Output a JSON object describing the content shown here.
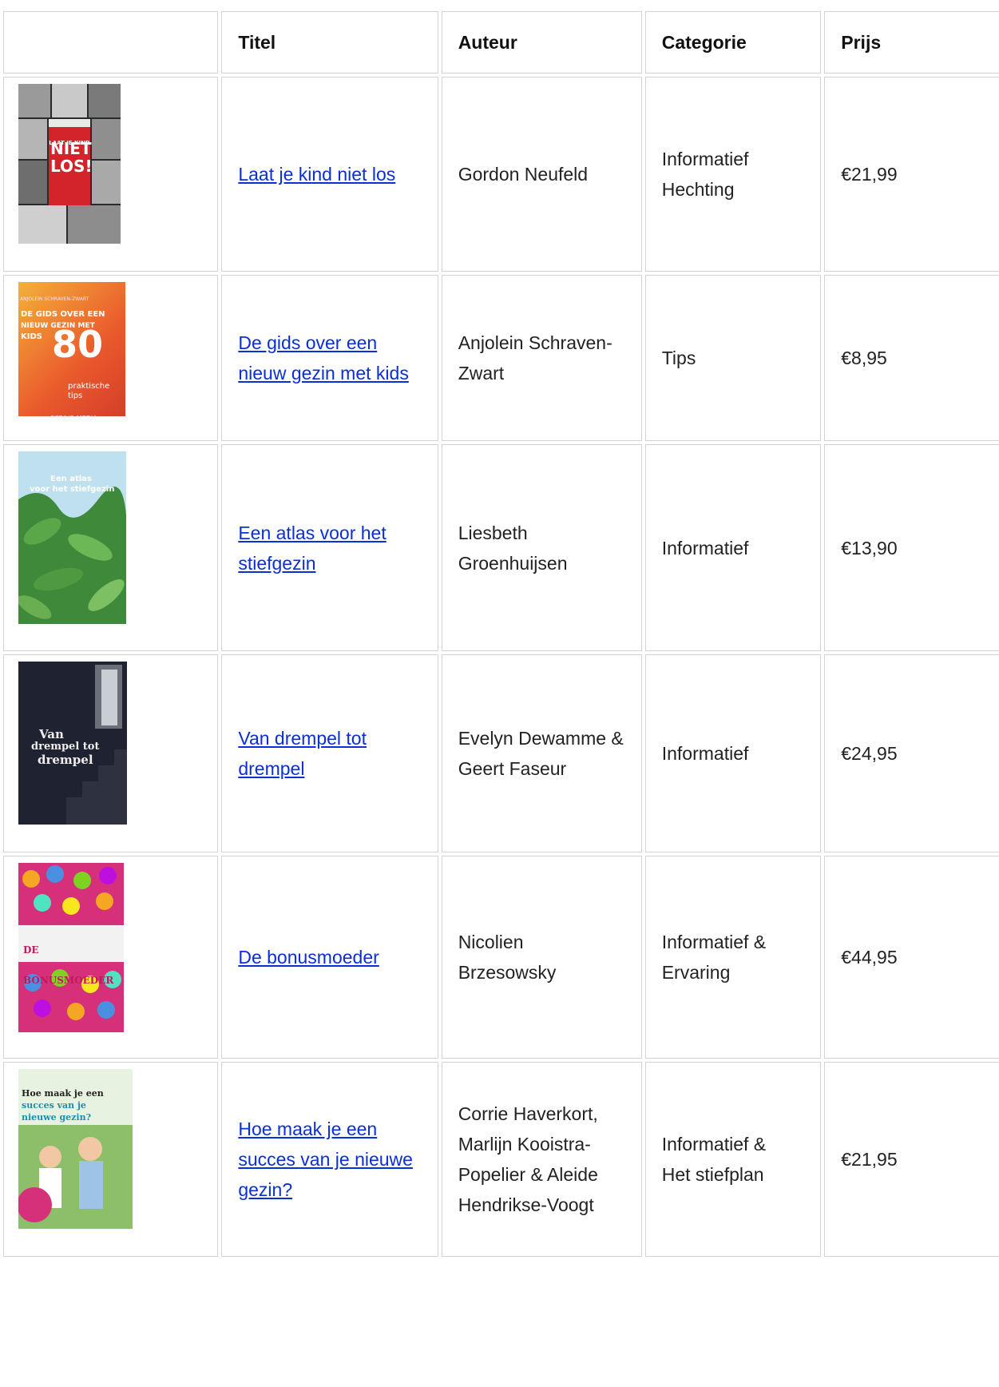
{
  "table": {
    "headers": [
      "",
      "Titel",
      "Auteur",
      "Categorie",
      "Prijs"
    ],
    "rows": [
      {
        "title": "Laat je kind niet los",
        "author": "Gordon Neufeld",
        "category_lines": [
          "Informatief",
          "Hechting"
        ],
        "price": "€21,99",
        "cover": {
          "icon": "book-cover-laat-je-kind-niet-los",
          "main": "NIET LOS!",
          "top": "LAAT JE KIND",
          "accent": "#d4242b"
        }
      },
      {
        "title": "De gids over een nieuw gezin met kids",
        "author": "Anjolein Schraven-Zwart",
        "category_lines": [
          "Tips"
        ],
        "price": "€8,95",
        "cover": {
          "icon": "book-cover-gids-nieuw-gezin",
          "top": "ANJOLEIN SCHRAVEN-ZWART",
          "l1": "DE GIDS OVER EEN",
          "l2": "NIEUW GEZIN MET",
          "l3": "KIDS",
          "big": "80",
          "sub1": "praktische",
          "sub2": "tips",
          "bottom": "SCRIVO MEDIA",
          "accent": "#f07a2a"
        }
      },
      {
        "title": "Een atlas voor het stiefgezin",
        "author": "Liesbeth Groenhuijsen",
        "category_lines": [
          "Informatief"
        ],
        "price": "€13,90",
        "cover": {
          "icon": "book-cover-atlas-stiefgezin",
          "l1": "Een atlas",
          "l2": "voor het stiefgezin",
          "accent": "#3f8a3a"
        }
      },
      {
        "title": "Van drempel tot drempel",
        "author": "Evelyn Dewamme & Geert Faseur",
        "category_lines": [
          "Informatief"
        ],
        "price": "€24,95",
        "cover": {
          "icon": "book-cover-van-drempel-tot-drempel",
          "l1": "Van",
          "l2": "drempel tot",
          "l3": "drempel",
          "accent": "#1f2230"
        }
      },
      {
        "title": "De bonusmoeder",
        "author": "Nicolien Brzesowsky",
        "category_lines": [
          "Informatief &",
          "Ervaring"
        ],
        "price": "€44,95",
        "cover": {
          "icon": "book-cover-de-bonusmoeder",
          "main": "DE BONUSMOEDER",
          "accent": "#d6307a"
        }
      },
      {
        "title": "Hoe maak je een succes van je nieuwe gezin?",
        "author": "Corrie Haverkort, Marlijn Kooistra-Popelier & Aleide Hendrikse-Voogt",
        "category_lines": [
          "Informatief &",
          "Het stiefplan"
        ],
        "price": "€21,95",
        "cover": {
          "icon": "book-cover-hoe-maak-je-een-succes",
          "l1": "Hoe maak je een",
          "l2": "succes van je",
          "l3": "nieuwe gezin?",
          "accent": "#1b8fb0"
        }
      }
    ]
  }
}
